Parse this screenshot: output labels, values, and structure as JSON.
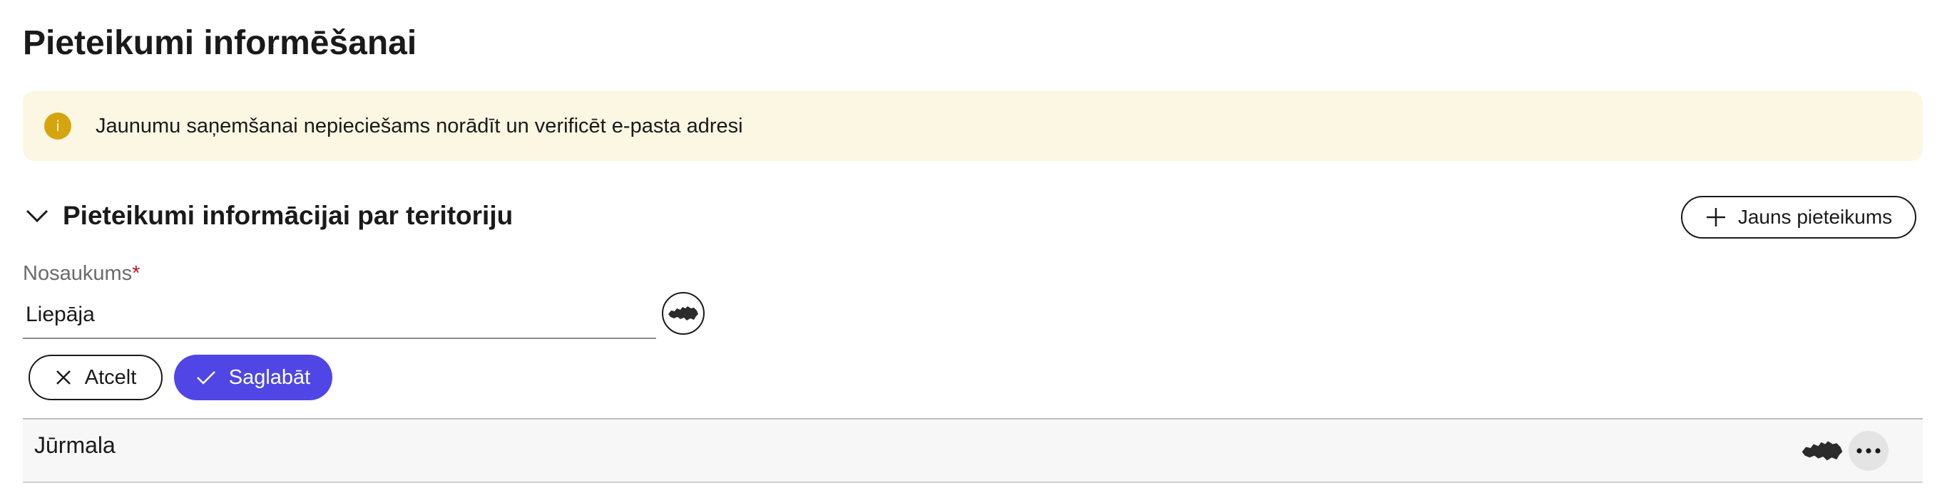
{
  "page": {
    "title": "Pieteikumi informēšanai"
  },
  "info_banner": {
    "icon": "info-icon",
    "icon_glyph": "i",
    "text": "Jaunumu saņemšanai nepieciešams norādīt un verificēt e-pasta adresi",
    "background": "#fcf7e3",
    "icon_color": "#d4a50e"
  },
  "section": {
    "title": "Pieteikumi informācijai par teritoriju",
    "expanded": true,
    "new_button_label": "Jauns pieteikums"
  },
  "form": {
    "name_label": "Nosaukums",
    "required_mark": "*",
    "name_value": "Liepāja",
    "cancel_label": "Atcelt",
    "save_label": "Saglabāt",
    "save_color": "#4f46e5"
  },
  "list": {
    "items": [
      {
        "label": "Jūrmala",
        "icon": "latvia-map-icon"
      }
    ]
  }
}
